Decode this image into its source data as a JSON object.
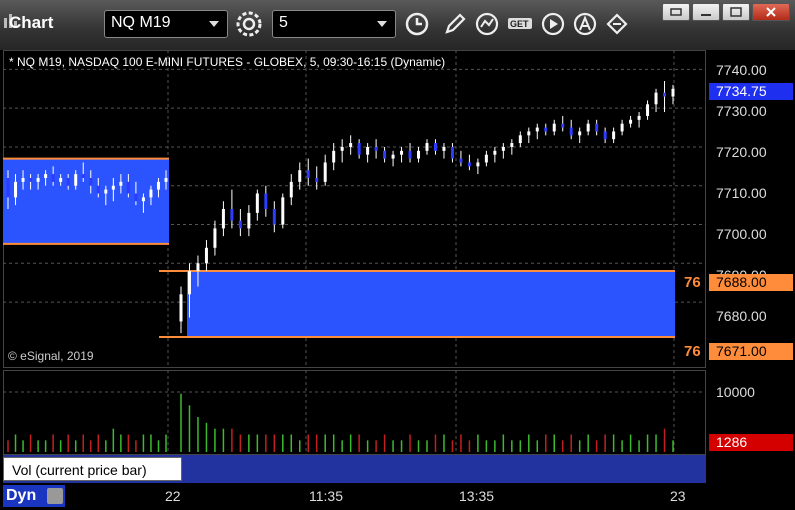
{
  "toolbar": {
    "app_title": "Chart",
    "symbol_value": "NQ M19",
    "interval_value": "5"
  },
  "chart": {
    "info_line": "* NQ M19, NASDAQ 100 E-MINI FUTURES - GLOBEX, 5, 09:30-16:15 (Dynamic)",
    "copyright": "© eSignal, 2019",
    "price_ticks": [
      "7740.00",
      "7730.00",
      "7720.00",
      "7710.00",
      "7700.00",
      "7690.00",
      "7680.00"
    ],
    "last_price": "7734.75",
    "upper_zone_label": "7688.00",
    "lower_zone_label": "7671.00",
    "zone_left_labels": [
      "76",
      "76"
    ],
    "vol_ticks": [
      "10000"
    ],
    "last_volume": "1286",
    "vol_label": "Vol (current price bar)",
    "vol_close": "×",
    "time_labels": [
      "22",
      "11:35",
      "13:35",
      "23"
    ],
    "dyn_label": "Dyn",
    "colors": {
      "zone_blue": "#2b54ff",
      "zone_edge": "#ff8c3a",
      "last_price_bg": "#1f2ff0",
      "volume_tag_bg": "#d40000",
      "up_volume": "#3dbb2f",
      "down_volume": "#c22020",
      "candle": "#ffffff",
      "candle_down": "#2d3cff"
    }
  },
  "chart_data": {
    "type": "candlestick",
    "ylim": [
      7663,
      7745
    ],
    "candles": [
      [
        7712,
        7714,
        7704,
        7707
      ],
      [
        7707,
        7713,
        7705,
        7711
      ],
      [
        7711,
        7714,
        7709,
        7712
      ],
      [
        7712,
        7713,
        7709,
        7711
      ],
      [
        7711,
        7713,
        7709,
        7712
      ],
      [
        7712,
        7714,
        7710,
        7713
      ],
      [
        7713,
        7715,
        7710,
        7711
      ],
      [
        7711,
        7713,
        7710,
        7712
      ],
      [
        7712,
        7713,
        7709,
        7710
      ],
      [
        7710,
        7714,
        7709,
        7713
      ],
      [
        7713,
        7716,
        7711,
        7712
      ],
      [
        7712,
        7714,
        7708,
        7710
      ],
      [
        7710,
        7712,
        7707,
        7708
      ],
      [
        7708,
        7710,
        7705,
        7709
      ],
      [
        7709,
        7712,
        7706,
        7710
      ],
      [
        7710,
        7713,
        7708,
        7711
      ],
      [
        7711,
        7713,
        7707,
        7708
      ],
      [
        7708,
        7711,
        7705,
        7706
      ],
      [
        7706,
        7708,
        7703,
        7707
      ],
      [
        7707,
        7710,
        7705,
        7709
      ],
      [
        7709,
        7712,
        7707,
        7711
      ],
      [
        7711,
        7714,
        7709,
        7712
      ],
      [
        7675,
        7684,
        7672,
        7682
      ],
      [
        7682,
        7690,
        7676,
        7688
      ],
      [
        7688,
        7692,
        7684,
        7690
      ],
      [
        7690,
        7696,
        7688,
        7694
      ],
      [
        7694,
        7701,
        7692,
        7699
      ],
      [
        7699,
        7706,
        7697,
        7704
      ],
      [
        7704,
        7709,
        7699,
        7701
      ],
      [
        7701,
        7704,
        7697,
        7699
      ],
      [
        7699,
        7705,
        7697,
        7703
      ],
      [
        7703,
        7709,
        7701,
        7708
      ],
      [
        7708,
        7710,
        7702,
        7704
      ],
      [
        7704,
        7706,
        7698,
        7700
      ],
      [
        7700,
        7708,
        7699,
        7707
      ],
      [
        7707,
        7713,
        7705,
        7711
      ],
      [
        7711,
        7716,
        7709,
        7714
      ],
      [
        7714,
        7717,
        7710,
        7712
      ],
      [
        7712,
        7715,
        7709,
        7711
      ],
      [
        7711,
        7718,
        7710,
        7716
      ],
      [
        7716,
        7721,
        7714,
        7719
      ],
      [
        7719,
        7722,
        7716,
        7720
      ],
      [
        7720,
        7723,
        7718,
        7721
      ],
      [
        7721,
        7722,
        7717,
        7718
      ],
      [
        7718,
        7721,
        7716,
        7720
      ],
      [
        7720,
        7722,
        7717,
        7719
      ],
      [
        7719,
        7720,
        7716,
        7717
      ],
      [
        7717,
        7719,
        7715,
        7718
      ],
      [
        7718,
        7720,
        7716,
        7719
      ],
      [
        7719,
        7721,
        7716,
        7717
      ],
      [
        7717,
        7720,
        7716,
        7719
      ],
      [
        7719,
        7722,
        7718,
        7721
      ],
      [
        7721,
        7722,
        7718,
        7719
      ],
      [
        7719,
        7721,
        7717,
        7720
      ],
      [
        7720,
        7721,
        7716,
        7717
      ],
      [
        7717,
        7719,
        7715,
        7716
      ],
      [
        7716,
        7718,
        7714,
        7715
      ],
      [
        7715,
        7717,
        7713,
        7716
      ],
      [
        7716,
        7719,
        7715,
        7718
      ],
      [
        7718,
        7720,
        7716,
        7719
      ],
      [
        7719,
        7721,
        7717,
        7720
      ],
      [
        7720,
        7722,
        7718,
        7721
      ],
      [
        7721,
        7724,
        7720,
        7723
      ],
      [
        7723,
        7725,
        7721,
        7724
      ],
      [
        7724,
        7726,
        7722,
        7725
      ],
      [
        7725,
        7726,
        7723,
        7724
      ],
      [
        7724,
        7727,
        7723,
        7726
      ],
      [
        7726,
        7728,
        7724,
        7725
      ],
      [
        7725,
        7727,
        7722,
        7723
      ],
      [
        7723,
        7725,
        7721,
        7724
      ],
      [
        7724,
        7727,
        7723,
        7726
      ],
      [
        7726,
        7727,
        7723,
        7724
      ],
      [
        7724,
        7725,
        7721,
        7722
      ],
      [
        7722,
        7725,
        7721,
        7724
      ],
      [
        7724,
        7727,
        7723,
        7726
      ],
      [
        7726,
        7728,
        7725,
        7727
      ],
      [
        7727,
        7729,
        7725,
        7728
      ],
      [
        7728,
        7732,
        7727,
        7731
      ],
      [
        7731,
        7735,
        7729,
        7734
      ],
      [
        7734,
        7737,
        7729,
        7733
      ],
      [
        7733,
        7736,
        7731,
        7735
      ]
    ],
    "volume": [
      2,
      3,
      2,
      3,
      2,
      2,
      3,
      2,
      3,
      2,
      3,
      2,
      3,
      2,
      4,
      3,
      3,
      2,
      3,
      3,
      2,
      3,
      10,
      8,
      6,
      5,
      4,
      4,
      4,
      3,
      3,
      3,
      3,
      3,
      3,
      3,
      2,
      3,
      3,
      3,
      3,
      2,
      3,
      3,
      2,
      2,
      3,
      2,
      2,
      3,
      2,
      2,
      3,
      3,
      2,
      3,
      2,
      3,
      2,
      2,
      3,
      2,
      2,
      3,
      2,
      3,
      3,
      2,
      3,
      2,
      3,
      2,
      3,
      3,
      2,
      3,
      2,
      3,
      3,
      4,
      2
    ],
    "zones": [
      {
        "from_index": 0,
        "to_index": 21,
        "low": 7695,
        "high": 7717
      },
      {
        "from_index": 22,
        "to_index": 80,
        "low": 7671,
        "high": 7688
      }
    ]
  }
}
